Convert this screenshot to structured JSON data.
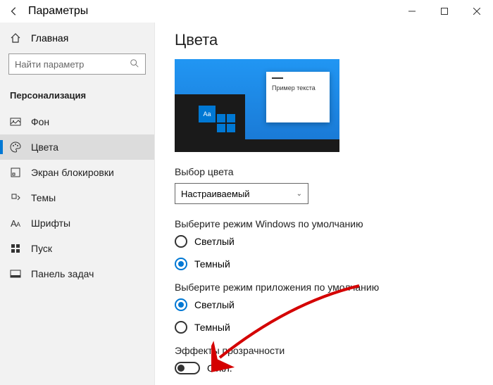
{
  "titlebar": {
    "title": "Параметры"
  },
  "sidebar": {
    "home": "Главная",
    "search_placeholder": "Найти параметр",
    "section": "Персонализация",
    "items": [
      {
        "label": "Фон"
      },
      {
        "label": "Цвета"
      },
      {
        "label": "Экран блокировки"
      },
      {
        "label": "Темы"
      },
      {
        "label": "Шрифты"
      },
      {
        "label": "Пуск"
      },
      {
        "label": "Панель задач"
      }
    ]
  },
  "content": {
    "title": "Цвета",
    "preview_sample_text": "Пример текста",
    "preview_tile_label": "Aa",
    "color_mode_label": "Выбор цвета",
    "color_mode_value": "Настраиваемый",
    "windows_mode_label": "Выберите режим Windows по умолчанию",
    "app_mode_label": "Выберите режим приложения по умолчанию",
    "light": "Светлый",
    "dark": "Темный",
    "transparency_label": "Эффекты прозрачности",
    "transparency_state": "Откл."
  }
}
